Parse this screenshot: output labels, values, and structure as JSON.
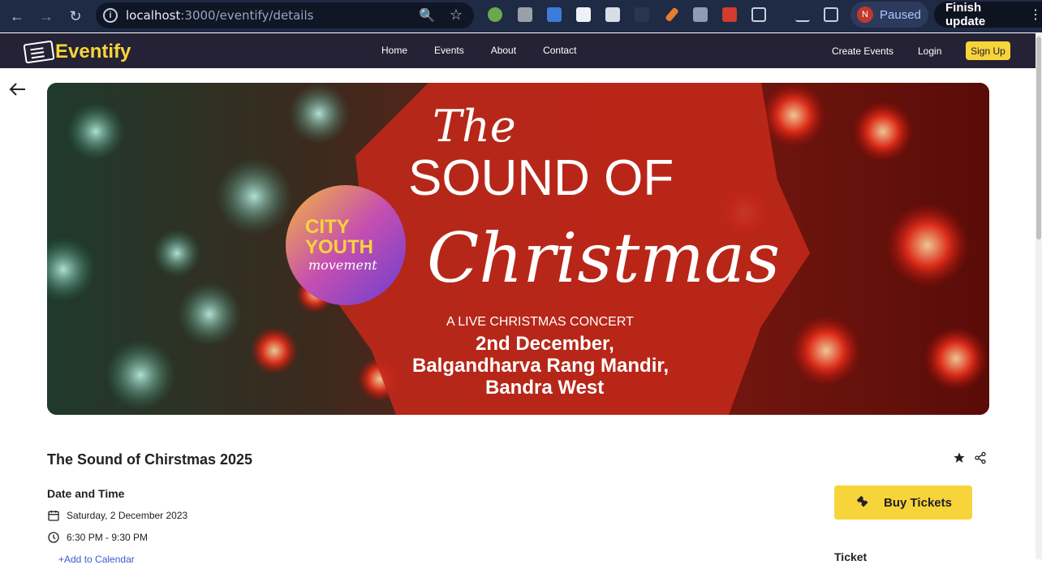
{
  "browser": {
    "url_host": "localhost",
    "url_path": ":3000/eventify/details",
    "profile_initial": "N",
    "profile_status": "Paused",
    "update_label": "Finish update"
  },
  "nav": {
    "brand": "Eventify",
    "links": [
      "Home",
      "Events",
      "About",
      "Contact"
    ],
    "create": "Create Events",
    "login": "Login",
    "signup": "Sign Up"
  },
  "banner": {
    "line_the": "The",
    "line_sound": "SOUND OF",
    "line_christmas": "Christmas",
    "badge_1": "CITY",
    "badge_2": "YOUTH",
    "badge_3": "movement",
    "subtitle": "A LIVE CHRISTMAS CONCERT",
    "date": "2nd December,",
    "venue_1": "Balgandharva Rang Mandir,",
    "venue_2": "Bandra West"
  },
  "event": {
    "title": "The Sound of Chirstmas 2025",
    "section_datetime": "Date and Time",
    "date": "Saturday, 2 December 2023",
    "time": "6:30 PM - 9:30 PM",
    "add_calendar": "+Add to Calendar",
    "buy_label": "Buy Tickets",
    "ticket_heading": "Ticket"
  },
  "colors": {
    "nav_bg": "#252235",
    "accent": "#f7d43a",
    "chrome_bg": "#1f2a44"
  }
}
